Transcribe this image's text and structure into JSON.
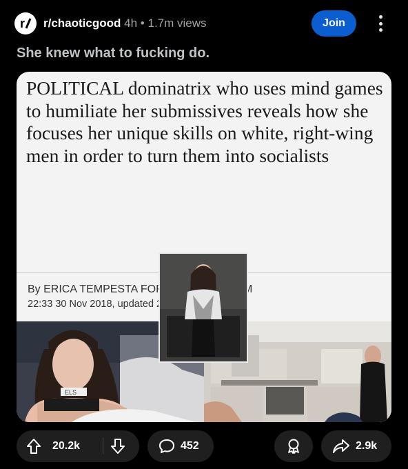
{
  "post": {
    "subreddit": "r/chaoticgood",
    "age": "4h",
    "separator": "•",
    "views": "1.7m views",
    "join_label": "Join",
    "title": "She knew what to fucking do."
  },
  "article": {
    "headline": "POLITICAL dominatrix who uses mind games to humiliate her submissives reveals how she focuses her unique skills on white, right-wing men in order to turn them into socialists",
    "byline": "By ERICA TEMPESTA FOR DAILYMAIL.COM",
    "dateline": "22:33 30 Nov 2018, updated 23:00 30 Nov 2018",
    "collar_text": "ELS"
  },
  "actions": {
    "upvotes": "20.2k",
    "comments": "452",
    "shares": "2.9k"
  },
  "icons": {
    "subreddit": "reddit-r-icon",
    "more": "vertical-dots-icon",
    "upvote": "up-arrow-icon",
    "downvote": "down-arrow-icon",
    "comment": "speech-bubble-icon",
    "award": "award-ribbon-icon",
    "share": "share-arrow-icon"
  },
  "colors": {
    "background": "#000000",
    "join": "#0a5ecf",
    "pill": "#1f1f1f",
    "card": "#f3f3f3"
  }
}
